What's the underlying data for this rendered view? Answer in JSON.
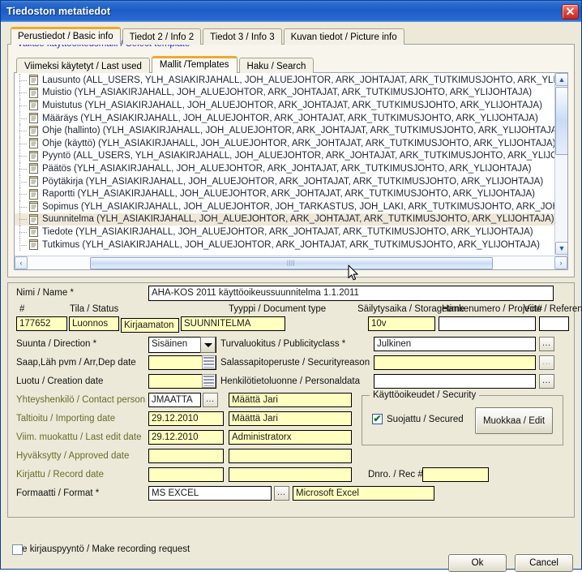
{
  "window": {
    "title": "Tiedoston metatiedot",
    "close_label": "✕"
  },
  "tabs": [
    {
      "label": "Perustiedot / Basic info",
      "active": true
    },
    {
      "label": "Tiedot 2 / Info 2",
      "active": false
    },
    {
      "label": "Tiedot 3 / Info 3",
      "active": false
    },
    {
      "label": "Kuvan tiedot / Picture info",
      "active": false
    }
  ],
  "template_group": {
    "legend": "Valitse käyttöoikeusmalli / Select template",
    "inner_tabs": [
      {
        "label": "Viimeksi käytetyt / Last used",
        "active": false
      },
      {
        "label": "Mallit /Templates",
        "active": true
      },
      {
        "label": "Haku / Search",
        "active": false
      }
    ],
    "rows": [
      {
        "label": "Lausunto (ALL_USERS, YLH_ASIAKIRJAHALL, JOH_ALUEJOHTOR, ARK_JOHTAJAT, ARK_TUTKIMUSJOHTO, ARK_YLIJOHT",
        "selected": false
      },
      {
        "label": "Muistio (YLH_ASIAKIRJAHALL, JOH_ALUEJOHTOR, ARK_JOHTAJAT, ARK_TUTKIMUSJOHTO, ARK_YLIJOHTAJA)",
        "selected": false
      },
      {
        "label": "Muistutus (YLH_ASIAKIRJAHALL, JOH_ALUEJOHTOR, ARK_JOHTAJAT, ARK_TUTKIMUSJOHTO, ARK_YLIJOHTAJA)",
        "selected": false
      },
      {
        "label": "Määräys (YLH_ASIAKIRJAHALL, JOH_ALUEJOHTOR, ARK_JOHTAJAT, ARK_TUTKIMUSJOHTO, ARK_YLIJOHTAJA)",
        "selected": false
      },
      {
        "label": "Ohje (hallinto) (YLH_ASIAKIRJAHALL, JOH_ALUEJOHTOR, ARK_JOHTAJAT, ARK_TUTKIMUSJOHTO, ARK_YLIJOHTAJA)",
        "selected": false
      },
      {
        "label": "Ohje (käyttö) (YLH_ASIAKIRJAHALL, JOH_ALUEJOHTOR, ARK_JOHTAJAT, ARK_TUTKIMUSJOHTO, ARK_YLIJOHTAJA)",
        "selected": false
      },
      {
        "label": "Pyyntö (ALL_USERS, YLH_ASIAKIRJAHALL, JOH_ALUEJOHTOR, ARK_JOHTAJAT, ARK_TUTKIMUSJOHTO, ARK_YLIJOHTA",
        "selected": false
      },
      {
        "label": "Päätös (YLH_ASIAKIRJAHALL, JOH_ALUEJOHTOR, ARK_JOHTAJAT, ARK_TUTKIMUSJOHTO, ARK_YLIJOHTAJA)",
        "selected": false
      },
      {
        "label": "Pöytäkirja (YLH_ASIAKIRJAHALL, JOH_ALUEJOHTOR, ARK_JOHTAJAT, ARK_TUTKIMUSJOHTO, ARK_YLIJOHTAJA)",
        "selected": false
      },
      {
        "label": "Raportti (YLH_ASIAKIRJAHALL, JOH_ALUEJOHTOR, ARK_JOHTAJAT, ARK_TUTKIMUSJOHTO, ARK_YLIJOHTAJA)",
        "selected": false
      },
      {
        "label": "Sopimus (YLH_ASIAKIRJAHALL, JOH_ALUEJOHTOR, JOH_TARKASTUS, JOH_LAKI, ARK_TUTKIMUSJOHTO, ARK_JOHTAJA",
        "selected": false
      },
      {
        "label": "Suunnitelma (YLH_ASIAKIRJAHALL, JOH_ALUEJOHTOR, ARK_JOHTAJAT, ARK_TUTKIMUSJOHTO, ARK_YLIJOHTAJA)",
        "selected": true
      },
      {
        "label": "Tiedote (YLH_ASIAKIRJAHALL, JOH_ALUEJOHTOR, ARK_JOHTAJAT, ARK_TUTKIMUSJOHTO, ARK_YLIJOHTAJA)",
        "selected": false
      },
      {
        "label": "Tutkimus (YLH_ASIAKIRJAHALL, JOH_ALUEJOHTOR, ARK_JOHTAJAT, ARK_TUTKIMUSJOHTO, ARK_YLIJOHTAJA)",
        "selected": false
      }
    ],
    "scroll_left_icon": "‹",
    "scroll_right_icon": "›",
    "scroll_up_icon": "▲",
    "scroll_down_icon": "▼",
    "thumb_grip": "||||"
  },
  "form": {
    "name_label": "Nimi / Name *",
    "name_value": "AHA-KOS 2011 käyttöoikeussuunnitelma 1.1.2011",
    "id_label": "#",
    "id_value": "177652",
    "status_label": "Tila / Status",
    "status_value": "Luonnos",
    "registration_value": "Kirjaamaton",
    "doctype_label": "Tyyppi / Document type",
    "doctype_value": "SUUNNITELMA",
    "storagetime_label": "Säilytysaika / Storagetime",
    "storagetime_value": "10v",
    "project_label": "Hankenumero / Project#",
    "project_value": "",
    "reference_label": "Viite / Reference",
    "reference_value": "",
    "direction_label": "Suunta / Direction *",
    "direction_value": "Sisäinen",
    "arrdep_label": "Saap,Läh pvm / Arr,Dep date",
    "arrdep_value": "",
    "creation_label": "Luotu / Creation date",
    "creation_value": "",
    "contact_label": "Yhteyshenkilö / Contact person ¹",
    "contact_value": "JMAATTA",
    "contact_name": "Määttä Jari",
    "importing_label": "Taltioitu / Importing date",
    "importing_value": "29.12.2010",
    "importing_user": "Määttä Jari",
    "lastedit_label": "Viim. muokattu / Last edit date",
    "lastedit_value": "29.12.2010",
    "lastedit_user": "Administratorx",
    "approved_label": "Hyväksytty / Approved date",
    "approved_value": "",
    "approved_user": "",
    "record_label": "Kirjattu / Record date",
    "record_value": "",
    "record_user": "",
    "dnro_label": "Dnro. / Rec #",
    "dnro_value": "",
    "format_label": "Formaatti / Format *",
    "format_value": "MS EXCEL",
    "format_desc": "Microsoft Excel",
    "publicity_label": "Turvaluokitus / Publicityclass *",
    "publicity_value": "Julkinen",
    "securityreason_label": "Salassapitoperuste / Securityreason",
    "securityreason_value": "",
    "personaldata_label": "Henkilötietoluonne / Personaldata",
    "personaldata_value": "",
    "ellipsis_label": "…"
  },
  "security_group": {
    "legend": "Käyttöoikeudet / Security",
    "secured_label": "Suojattu / Secured",
    "secured_checked": true,
    "edit_button": "Muokkaa / Edit"
  },
  "footer": {
    "recording_request_label": "Tee kirjauspyyntö / Make recording request",
    "recording_request_checked": false,
    "ok_label": "Ok",
    "cancel_label": "Cancel"
  }
}
